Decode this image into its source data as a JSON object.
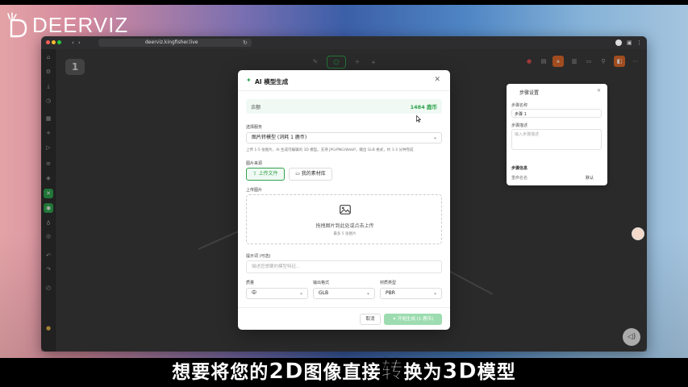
{
  "logo": {
    "text": "DEERVIZ"
  },
  "browser": {
    "url": "deerviz.kingfisher.live"
  },
  "canvas": {
    "step_number": "1"
  },
  "side_panel": {
    "title": "步骤设置",
    "name_label": "步骤名称",
    "name_value": "步骤 1",
    "desc_label": "步骤描述",
    "desc_placeholder": "输入步骤描述",
    "section": "步骤信息",
    "rename_label": "重命名名",
    "default_btn": "默认"
  },
  "modal": {
    "title": "AI 模型生成",
    "balance_label": "余额",
    "balance_value": "1484 鹿币",
    "service_label": "选择服务",
    "service_value": "图片转模型 (消耗 1 鹿币)",
    "service_hint": "上传 1-5 张图片，AI 生成可编辑的 3D 模型。支持 JPG/PNG/WebP，输出 GLB 格式，约 1-3 分钟完成",
    "source_label": "图片来源",
    "upload_btn": "上传文件",
    "library_btn": "我的素材库",
    "upload_label": "上传图片",
    "dropzone_text": "拖拽图片到此处或点击上传",
    "dropzone_sub": "最多 5 张图片",
    "prompt_label": "提示词 (可选)",
    "prompt_placeholder": "描述您想要的模型特征...",
    "quality_label": "质量",
    "quality_value": "中",
    "format_label": "输出格式",
    "format_value": "GLB",
    "material_label": "材质类型",
    "material_value": "PBR",
    "cancel_btn": "取消",
    "generate_btn": "开始生成 (1 鹿币)"
  },
  "subtitle": {
    "p1": "想要将您的",
    "h1": "2D",
    "p2": "图像直接",
    "h2": "转",
    "p3": "换为",
    "h3": "3D",
    "p4": "模型"
  }
}
